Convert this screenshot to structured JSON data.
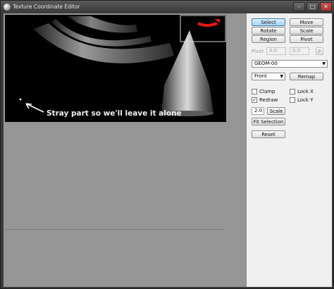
{
  "window": {
    "title": "Texture Coordinate Editor",
    "minimize": "–",
    "maximize": "□",
    "close": "✕"
  },
  "viewport": {
    "annotation": "Stray part so we'll leave it alone"
  },
  "panel": {
    "select": "Select",
    "move": "Move",
    "rotate": "Rotate",
    "scale": "Scale",
    "region": "Region",
    "pivot_button": "Pivot",
    "pivot_label": "Pivot",
    "pivot_x": "0.0",
    "pivot_y": "0.0",
    "pivot_p": "P",
    "geom_select": "GEOM-00",
    "view_select": "Front",
    "remap": "Remap",
    "clamp": "Clamp",
    "lock_x": "Lock X",
    "redraw": "Redraw",
    "lock_y": "Lock Y",
    "scale_value": "2.0",
    "scale_button": "Scale",
    "fit_selection": "Fit Selection",
    "reset": "Reset"
  },
  "checkboxes": {
    "clamp": false,
    "redraw": true,
    "lock_x": false,
    "lock_y": false
  },
  "active_tool": "Select"
}
